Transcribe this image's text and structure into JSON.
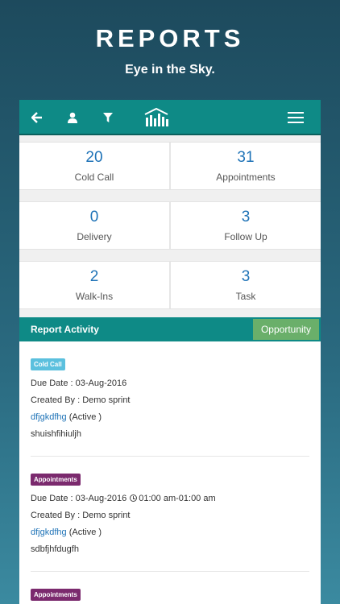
{
  "promo": {
    "title": "REPORTS",
    "subtitle": "Eye in the Sky."
  },
  "toolbar": {
    "icons": [
      "back-arrow-icon",
      "user-icon",
      "filter-icon",
      "chart-bars-icon",
      "menu-icon"
    ]
  },
  "stats": [
    {
      "value": "20",
      "label": "Cold Call"
    },
    {
      "value": "31",
      "label": "Appointments"
    },
    {
      "value": "0",
      "label": "Delivery"
    },
    {
      "value": "3",
      "label": "Follow Up"
    },
    {
      "value": "2",
      "label": "Walk-Ins"
    },
    {
      "value": "3",
      "label": "Task"
    }
  ],
  "report": {
    "title": "Report Activity",
    "opportunity_label": "Opportunity"
  },
  "activities": [
    {
      "tag": "Cold Call",
      "tag_color": "#5bc0de",
      "due": "Due Date : 03-Aug-2016",
      "time": "",
      "created": "Created By : Demo sprint",
      "link": "dfjgkdfhg",
      "status": " (Active )",
      "note": "shuishfihiuljh"
    },
    {
      "tag": "Appointments",
      "tag_color": "#7b2a6e",
      "due": "Due Date : 03-Aug-2016",
      "time": "01:00 am-01:00 am",
      "created": "Created By : Demo sprint",
      "link": "dfjgkdfhg",
      "status": " (Active )",
      "note": "sdbfjhfdugfh"
    },
    {
      "tag": "Appointments",
      "tag_color": "#7b2a6e"
    }
  ],
  "colors": {
    "accent": "#0e8a86",
    "value_blue": "#1f73b7",
    "opportunity_green": "#6aaf6a"
  }
}
